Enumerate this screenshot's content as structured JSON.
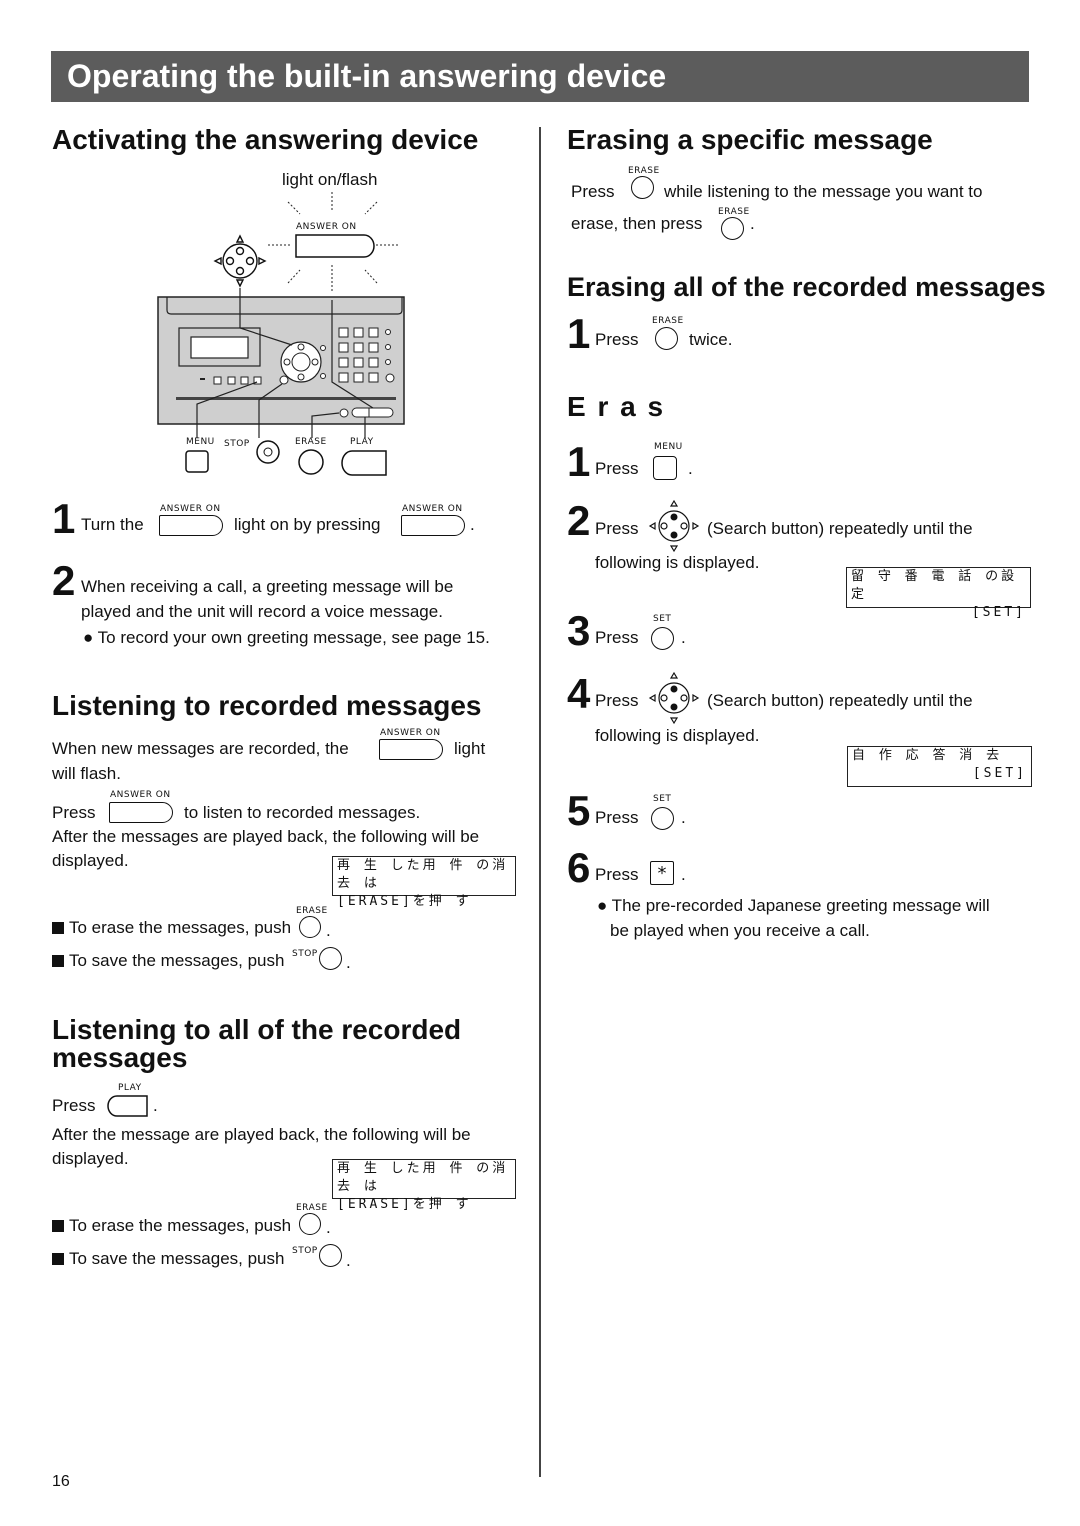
{
  "page": {
    "title": "Operating the built-in answering device",
    "page_number": "16",
    "accent_color": "#5c5c5c"
  },
  "labels": {
    "answer_on": "ANSWER ON",
    "erase": "ERASE",
    "menu": "MENU",
    "stop": "STOP",
    "play": "PLAY",
    "set": "SET",
    "star_key": "*",
    "light_on_flash": "light on/flash"
  },
  "activating": {
    "heading": "Activating the answering device",
    "step1": {
      "num": "1",
      "before": "Turn the",
      "middle": "light on by pressing",
      "after": "."
    },
    "step2": {
      "num": "2",
      "line1": "When receiving a call, a greeting message will be",
      "line2": "played and the unit will record a voice message.",
      "note": "● To record your own greeting message, see page 15."
    }
  },
  "listening": {
    "heading": "Listening to recorded messages",
    "line1_before": "When new messages are recorded, the",
    "line1_after": "light",
    "line2": "will flash.",
    "press": "Press",
    "press_after": "to listen to recorded messages.",
    "after_line1": "After the messages are played back, the following will be",
    "after_line2": "displayed.",
    "lcd_line1": "再 生 した用 件 の消 去 は",
    "lcd_line2": "[ERASE]を押 す",
    "erase_note": "To erase the messages, push",
    "save_note": "To save the messages, push",
    "period": "."
  },
  "listening_all": {
    "heading_line1": "Listening to all of the recorded",
    "heading_line2": "messages",
    "press": "Press",
    "period": ".",
    "after_line1": "After the message are played back, the following will be",
    "after_line2": "displayed.",
    "lcd_line1": "再 生 した用 件 の消 去 は",
    "lcd_line2": "[ERASE]を押 す",
    "erase_note": "To erase the messages, push",
    "save_note": "To save the messages, push"
  },
  "erasing_specific": {
    "heading": "Erasing a specific message",
    "press": "Press",
    "line1_after": "while listening to the message you want to",
    "line2_before": "erase, then press",
    "period": "."
  },
  "erasing_all": {
    "heading": "Erasing all of the recorded messages",
    "step1": {
      "num": "1",
      "press": "Press",
      "after": "twice."
    }
  },
  "erase_greeting": {
    "heading": "E r a s",
    "steps": [
      {
        "num": "1",
        "press": "Press",
        "after": "."
      },
      {
        "num": "2",
        "press": "Press",
        "after": "(Search button) repeatedly until the",
        "line2": "following is displayed.",
        "lcd_line1": "留 守 番 電 話 の設 定",
        "lcd_line2": "[SET]"
      },
      {
        "num": "3",
        "press": "Press",
        "after": "."
      },
      {
        "num": "4",
        "press": "Press",
        "after": "(Search button) repeatedly until the",
        "line2": "following is displayed.",
        "lcd_line1": "自 作 応 答 消 去",
        "lcd_line2": "[SET]"
      },
      {
        "num": "5",
        "press": "Press",
        "after": "."
      },
      {
        "num": "6",
        "press": "Press",
        "after": "."
      }
    ],
    "note_line1": "● The pre-recorded Japanese greeting message will",
    "note_line2": "be played when you receive a call."
  }
}
